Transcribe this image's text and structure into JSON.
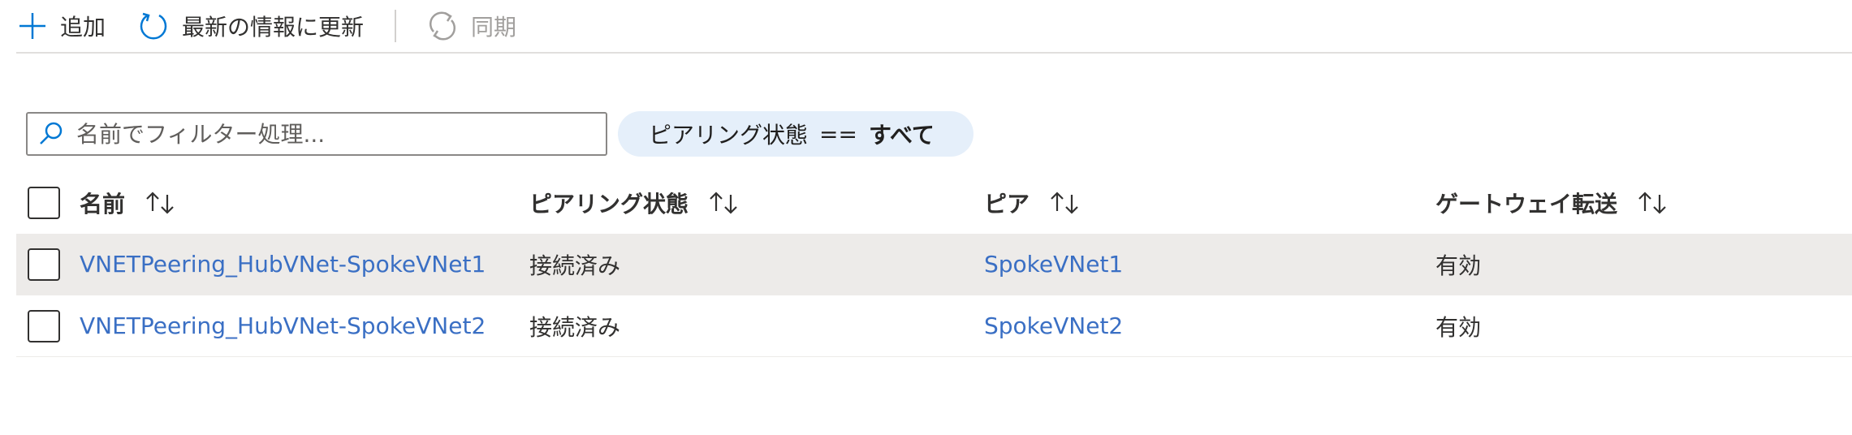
{
  "toolbar": {
    "add_label": "追加",
    "refresh_label": "最新の情報に更新",
    "sync_label": "同期"
  },
  "filter": {
    "search_placeholder": "名前でフィルター処理...",
    "pill_field": "ピアリング状態",
    "pill_operator": "==",
    "pill_value": "すべて"
  },
  "table": {
    "columns": [
      "名前",
      "ピアリング状態",
      "ピア",
      "ゲートウェイ転送"
    ],
    "rows": [
      {
        "name": "VNETPeering_HubVNet-SpokeVNet1",
        "state": "接続済み",
        "peer": "SpokeVNet1",
        "gateway_transit": "有効"
      },
      {
        "name": "VNETPeering_HubVNet-SpokeVNet2",
        "state": "接続済み",
        "peer": "SpokeVNet2",
        "gateway_transit": "有効"
      }
    ]
  },
  "colors": {
    "accent": "#0078d4",
    "link": "#3a6fc4",
    "selected_row": "#edebe9",
    "pill_bg": "#e5effa",
    "disabled_text": "#a19f9d"
  }
}
